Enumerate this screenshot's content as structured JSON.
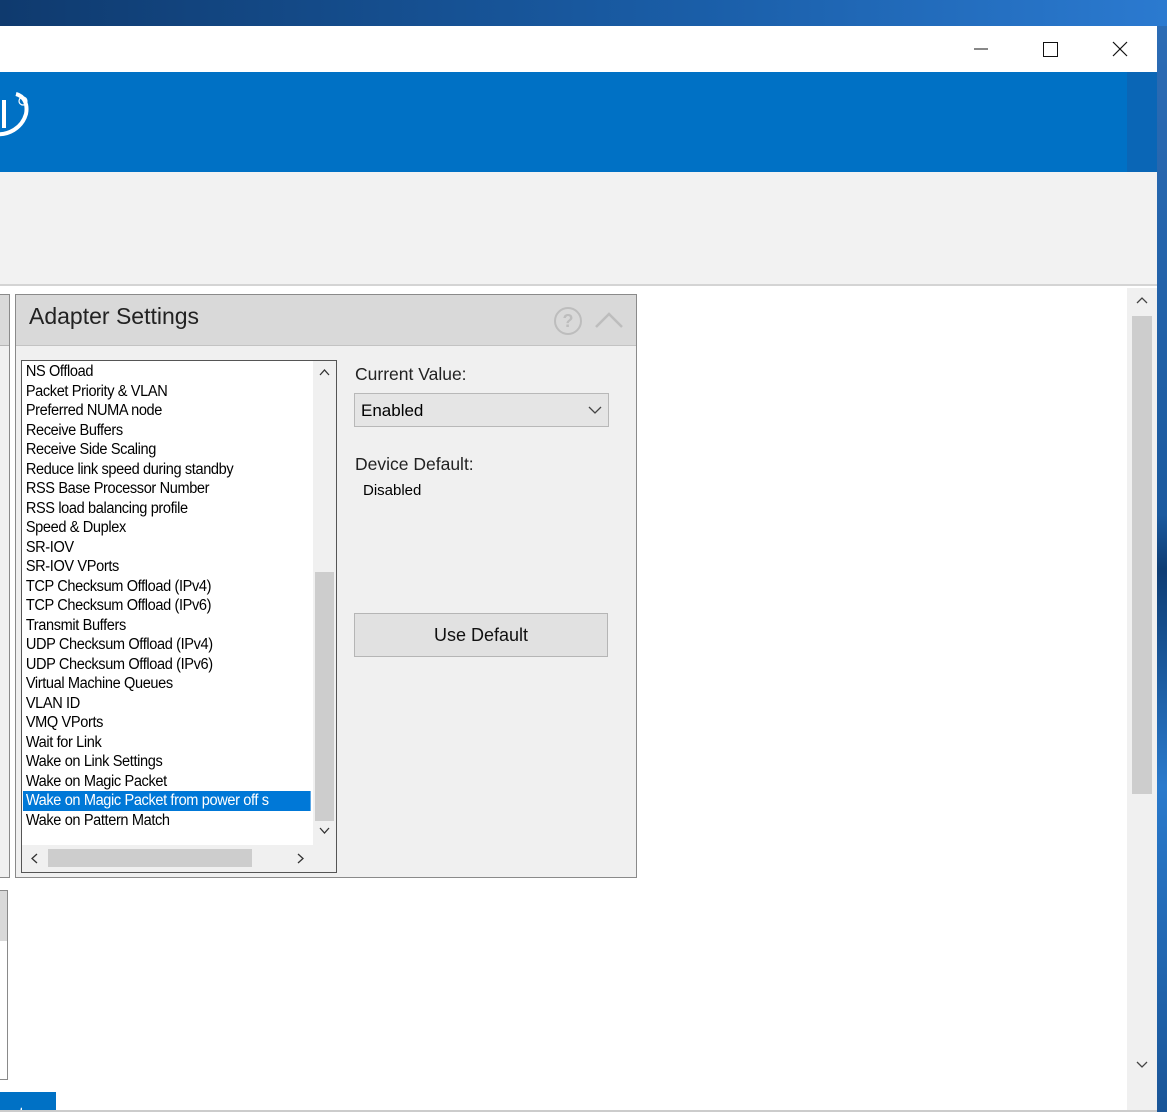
{
  "window": {
    "controls": {
      "minimize": "minimize",
      "maximize": "maximize",
      "close": "close"
    }
  },
  "adapter_settings": {
    "title": "Adapter Settings",
    "properties": [
      "NS Offload",
      "Packet Priority & VLAN",
      "Preferred NUMA node",
      "Receive Buffers",
      "Receive Side Scaling",
      "Reduce link speed during standby",
      "RSS Base Processor Number",
      "RSS load balancing profile",
      "Speed & Duplex",
      "SR-IOV",
      "SR-IOV VPorts",
      "TCP Checksum Offload (IPv4)",
      "TCP Checksum Offload (IPv6)",
      "Transmit Buffers",
      "UDP Checksum Offload (IPv4)",
      "UDP Checksum Offload (IPv6)",
      "Virtual Machine Queues",
      "VLAN ID",
      "VMQ VPorts",
      "Wait for Link",
      "Wake on Link Settings",
      "Wake on Magic Packet",
      "Wake on Magic Packet from power off s",
      "Wake on Pattern Match"
    ],
    "selected_index": 22,
    "current_value_label": "Current Value:",
    "current_value": "Enabled",
    "device_default_label": "Device Default:",
    "device_default_value": "Disabled",
    "use_default_label": "Use Default"
  },
  "bottom_button": {
    "label": "ter"
  },
  "colors": {
    "accent": "#0071c5",
    "selection": "#0078d7"
  }
}
